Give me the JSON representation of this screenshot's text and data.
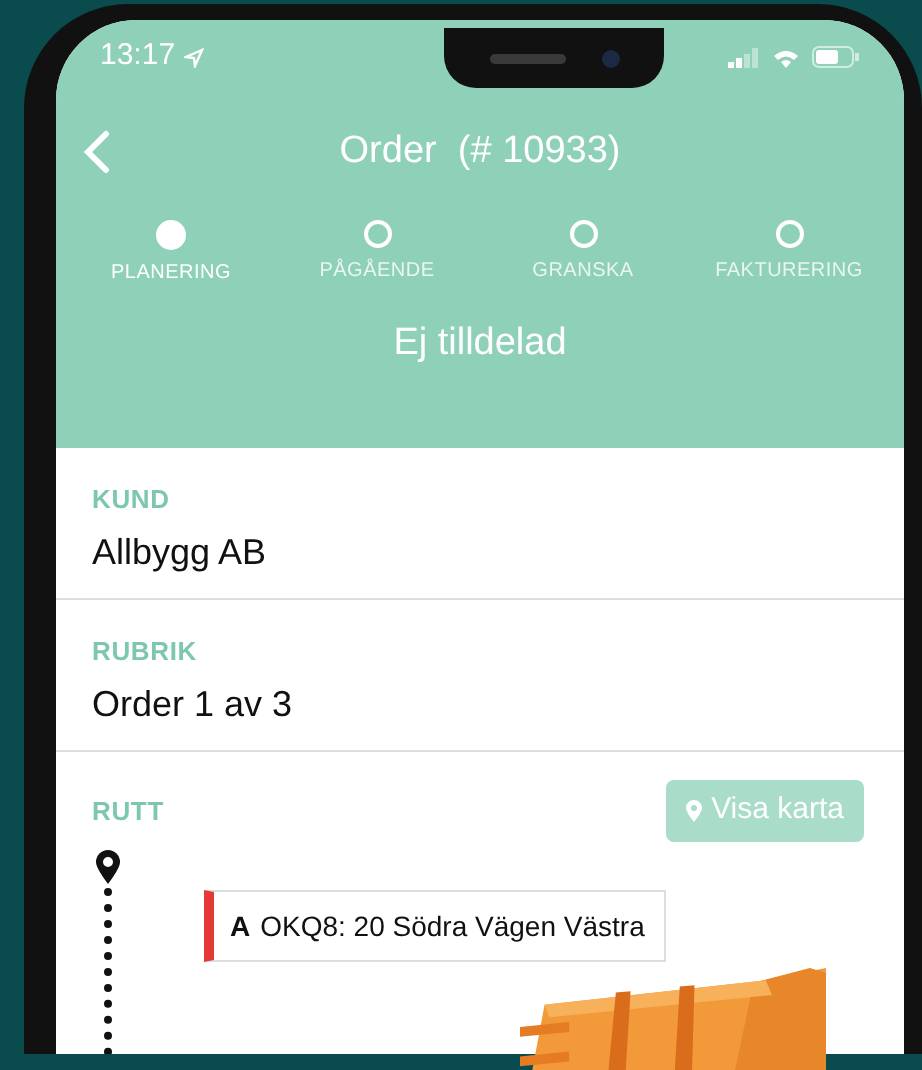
{
  "status_bar": {
    "time": "13:17"
  },
  "header": {
    "title": "Order  (# 10933)"
  },
  "steps": [
    {
      "label": "PLANERING",
      "selected": true
    },
    {
      "label": "PÅGÅENDE",
      "selected": false
    },
    {
      "label": "GRANSKA",
      "selected": false
    },
    {
      "label": "FAKTURERING",
      "selected": false
    }
  ],
  "assignment": "Ej tilldelad",
  "fields": [
    {
      "label": "KUND",
      "value": "Allbygg AB"
    },
    {
      "label": "RUBRIK",
      "value": "Order 1 av 3"
    }
  ],
  "route": {
    "label": "RUTT",
    "map_button": "Visa karta",
    "stops": [
      {
        "letter": "A",
        "text": "OKQ8: 20 Södra Vägen Västra"
      }
    ]
  }
}
